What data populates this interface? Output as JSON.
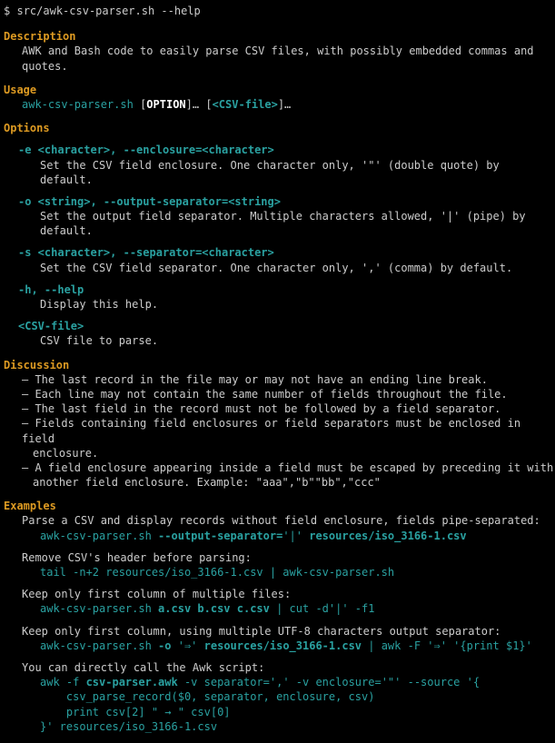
{
  "cmd": {
    "prompt": "$",
    "command": "src/awk-csv-parser.sh --help"
  },
  "sections": {
    "description": {
      "title": "Description",
      "text": "AWK and Bash code to easily parse CSV files, with possibly embedded commas and quotes."
    },
    "usage": {
      "title": "Usage",
      "cmd": "awk-csv-parser.sh",
      "opt_open": "[",
      "opt_word": "OPTION",
      "opt_close": "]…",
      "file_open": "[",
      "file_word": "<CSV-file>",
      "file_close": "]…"
    },
    "options": {
      "title": "Options",
      "e": {
        "flags": "-e <character>, --enclosure=<character>",
        "desc": "Set the CSV field enclosure. One character only, '\"' (double quote) by default."
      },
      "o": {
        "flags": "-o <string>, --output-separator=<string>",
        "desc": "Set the output field separator. Multiple characters allowed, '|' (pipe) by default."
      },
      "s": {
        "flags": "-s <character>, --separator=<character>",
        "desc": "Set the CSV field separator. One character only, ',' (comma) by default."
      },
      "h": {
        "flags": "-h, --help",
        "desc": "Display this help."
      },
      "file": {
        "flags": "<CSV-file>",
        "desc": "CSV file to parse."
      }
    },
    "discussion": {
      "title": "Discussion",
      "b1": "– The last record in the file may or may not have an ending line break.",
      "b2": "– Each line may not contain the same number of fields throughout the file.",
      "b3": "– The last field in the record must not be followed by a field separator.",
      "b4a": "– Fields containing field enclosures or field separators must be enclosed in field",
      "b4b": "enclosure.",
      "b5a": "– A field enclosure appearing inside a field must be escaped by preceding it with",
      "b5b": "another field enclosure. Example: \"aaa\",\"b\"\"bb\",\"ccc\""
    },
    "examples": {
      "title": "Examples",
      "ex1_desc": "Parse a CSV and display records without field enclosure, fields pipe-separated:",
      "ex1_cmd_a": "awk-csv-parser.sh ",
      "ex1_cmd_b": "--output-separator=",
      "ex1_cmd_c": "'|' ",
      "ex1_cmd_d": "resources/iso_3166-1.csv",
      "ex2_desc": "Remove CSV's header before parsing:",
      "ex2_cmd": "tail -n+2 resources/iso_3166-1.csv | awk-csv-parser.sh",
      "ex3_desc": "Keep only first column of multiple files:",
      "ex3_cmd_a": "awk-csv-parser.sh ",
      "ex3_cmd_b": "a.csv b.csv c.csv",
      "ex3_cmd_c": " | cut -d'|' -f1",
      "ex4_desc": "Keep only first column, using multiple UTF-8 characters output separator:",
      "ex4_cmd_a": "awk-csv-parser.sh ",
      "ex4_cmd_b": "-o ",
      "ex4_cmd_c": "'⇒' ",
      "ex4_cmd_d": "resources/iso_3166-1.csv",
      "ex4_cmd_e": " | awk -F '⇒' '{print $1}'",
      "ex5_desc": "You can directly call the Awk script:",
      "ex5_l1_a": "awk -f ",
      "ex5_l1_b": "csv-parser.awk",
      "ex5_l1_c": " -v separator=',' -v enclosure='\"' --source '{",
      "ex5_l2": "    csv_parse_record($0, separator, enclosure, csv)",
      "ex5_l3": "    print csv[2] \" → \" csv[0]",
      "ex5_l4": "}' resources/iso_3166-1.csv"
    }
  }
}
